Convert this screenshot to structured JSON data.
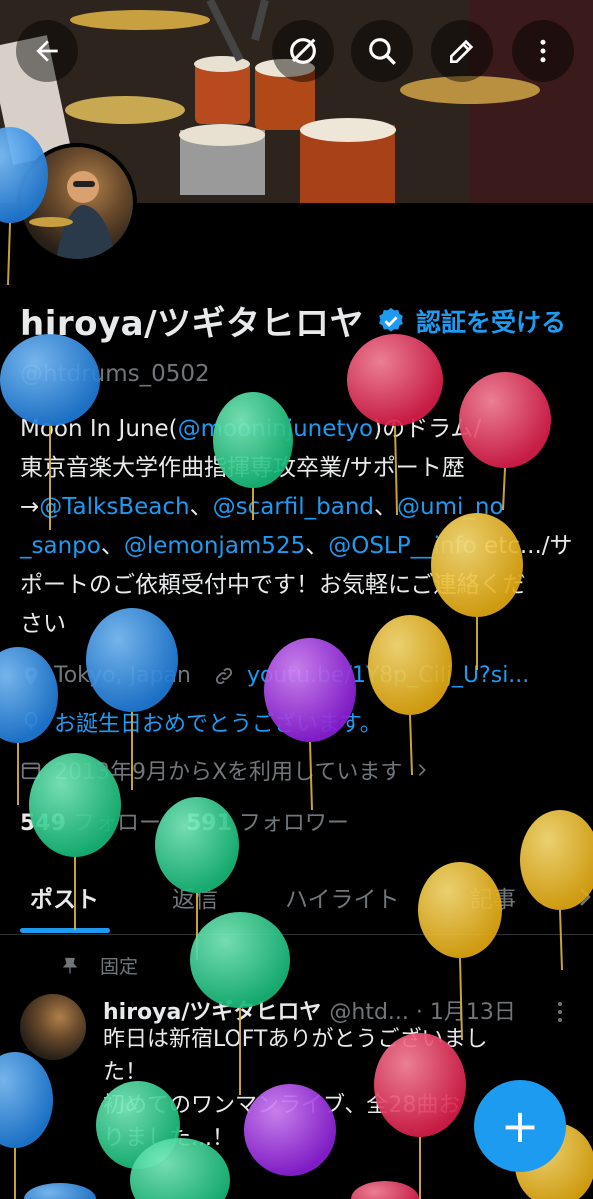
{
  "topbar": {
    "back_icon": "arrow-left-icon",
    "actions": [
      "grok-icon",
      "search-icon",
      "edit-icon",
      "more-vertical-icon"
    ]
  },
  "profile": {
    "name": "hiroya/ツギタヒロヤ",
    "verify_label": "認証を受ける",
    "handle": "@htdrums_0502",
    "bio": {
      "line1_a": "Moon In June(",
      "line1_link": "@mooninjunetyo",
      "line1_b": ")のドラム/",
      "line2": "東京音楽大学作曲指揮専攻卒業/サポート歴",
      "line3_a": "→",
      "line3_link1": "@TalksBeach",
      "line3_sep1": "、",
      "line3_link2": "@scarfil_band",
      "line3_sep2": "、",
      "line3_link3": "@umi_no",
      "line4_link3b": "_sanpo",
      "line4_sep1": "、",
      "line4_link4": "@lemonjam525",
      "line4_sep2": "、",
      "line4_link5": "@OSLP__info",
      "line4_b": " etc.../サ",
      "line5": "ポートのご依頼受付中です！お気軽にご連絡くだ",
      "line6": "さい"
    },
    "location": "Tokyo, Japan",
    "website": "youtu.be/1Y8p_Cilj_U?si...",
    "birthday": "お誕生日おめでとうございます。",
    "joined": "2013年9月からXを利用しています",
    "following_count": "549",
    "following_label": "フォロー",
    "followers_count": "591",
    "followers_label": "フォロワー"
  },
  "tabs": [
    "ポスト",
    "返信",
    "ハイライト",
    "記事"
  ],
  "post": {
    "pinned_label": "固定",
    "author": "hiroya/ツギタヒロヤ",
    "meta": "@htd... · 1月13日",
    "text_lines": [
      "昨日は新宿LOFTありがとうございまし",
      "た！",
      "初めてのワンマンライブ、全28曲お",
      "りました...！"
    ]
  },
  "fab": {
    "label": "+"
  },
  "colors": {
    "accent": "#1d9bf0",
    "text": "#e7e9ea",
    "muted": "#71767b",
    "bg": "#000000"
  }
}
